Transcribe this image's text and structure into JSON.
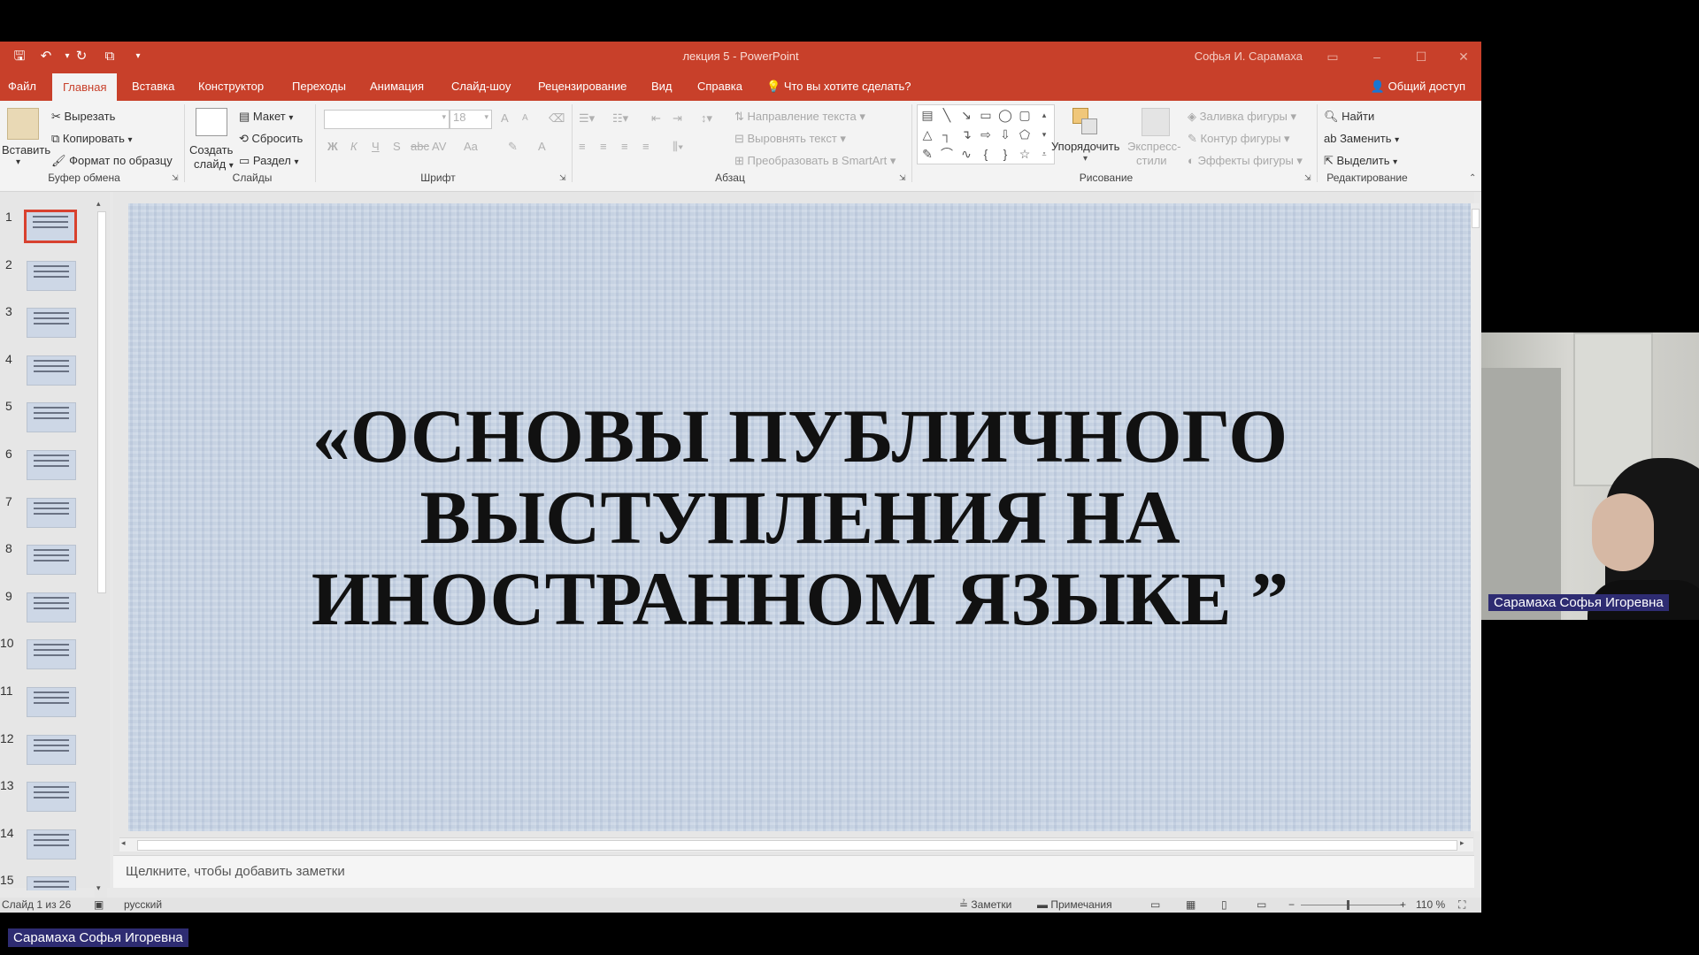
{
  "window": {
    "doc_title": "лекция 5 - PowerPoint",
    "user_name": "Софья И. Сарамаха",
    "minimize": "–",
    "maximize": "☐",
    "close": "✕"
  },
  "quick_access": {
    "save_icon": "save-icon",
    "undo_icon": "undo-icon",
    "redo_icon": "redo-icon",
    "present_icon": "present-icon",
    "customize_icon": "customize-icon"
  },
  "tabs": [
    "Файл",
    "Главная",
    "Вставка",
    "Конструктор",
    "Переходы",
    "Анимация",
    "Слайд-шоу",
    "Рецензирование",
    "Вид",
    "Справка"
  ],
  "tell_me": "Что вы хотите сделать?",
  "share": "Общий доступ",
  "ribbon": {
    "clipboard": {
      "paste": "Вставить",
      "cut": "Вырезать",
      "copy": "Копировать",
      "format_painter": "Формат по образцу",
      "label": "Буфер обмена"
    },
    "slides": {
      "new_slide_1": "Создать",
      "new_slide_2": "слайд",
      "layout": "Макет",
      "reset": "Сбросить",
      "section": "Раздел",
      "label": "Слайды"
    },
    "font": {
      "font_name": "",
      "font_size": "18",
      "label": "Шрифт",
      "bold": "Ж",
      "italic": "К",
      "underline": "Ч",
      "shadow": "S",
      "strike": "abc",
      "spacing": "AV",
      "case": "Aa",
      "color": "A",
      "grow": "A",
      "shrink": "A"
    },
    "paragraph": {
      "text_direction": "Направление текста",
      "align_text": "Выровнять текст",
      "smartart": "Преобразовать в SmartArt",
      "label": "Абзац"
    },
    "drawing": {
      "arrange": "Упорядочить",
      "quick_styles_1": "Экспресс-",
      "quick_styles_2": "стили",
      "shape_fill": "Заливка фигуры",
      "shape_outline": "Контур фигуры",
      "shape_effects": "Эффекты фигуры",
      "label": "Рисование"
    },
    "editing": {
      "find": "Найти",
      "replace": "Заменить",
      "select": "Выделить",
      "label": "Редактирование"
    }
  },
  "thumbnails": [
    "1",
    "2",
    "3",
    "4",
    "5",
    "6",
    "7",
    "8",
    "9",
    "10",
    "11",
    "12",
    "13",
    "14",
    "15"
  ],
  "slide": {
    "title": "«ОСНОВЫ ПУБЛИЧНОГО ВЫСТУПЛЕНИЯ НА ИНОСТРАННОМ ЯЗЫКЕ ”"
  },
  "notes_placeholder": "Щелкните, чтобы добавить заметки",
  "status": {
    "slide_count": "Слайд 1 из 26",
    "language": "русский",
    "notes": "Заметки",
    "comments": "Примечания",
    "zoom": "110 %"
  },
  "participant_name": "Сарамаха Софья Игоревна",
  "host_name": "Сарамаха Софья Игоревна",
  "colors": {
    "accent": "#c8402a",
    "slide_bg": "#c9d5e5",
    "name_label": "#2e2c72"
  }
}
